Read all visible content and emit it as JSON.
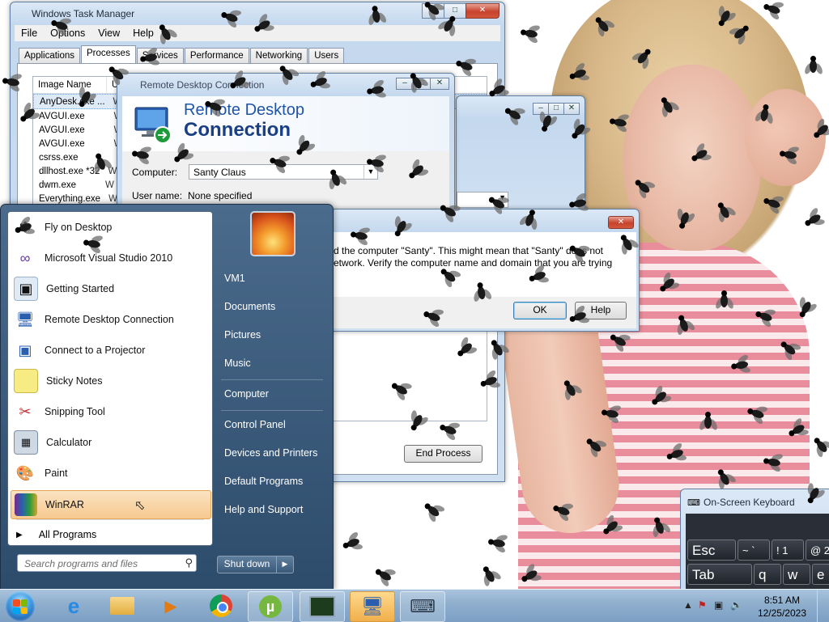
{
  "taskmanager": {
    "title": "Windows Task Manager",
    "menu": [
      "File",
      "Options",
      "View",
      "Help"
    ],
    "tabs": [
      "Applications",
      "Processes",
      "Services",
      "Performance",
      "Networking",
      "Users"
    ],
    "active_tab": "Processes",
    "columns": [
      "Image Name",
      "U"
    ],
    "rows": [
      {
        "name": "AnyDesk.exe ...",
        "u": "W"
      },
      {
        "name": "AVGUI.exe",
        "u": "W"
      },
      {
        "name": "AVGUI.exe",
        "u": "W"
      },
      {
        "name": "AVGUI.exe",
        "u": "W"
      },
      {
        "name": "csrss.exe",
        "u": ""
      },
      {
        "name": "dllhost.exe *32",
        "u": "W"
      },
      {
        "name": "dwm.exe",
        "u": "W"
      },
      {
        "name": "Everything.exe",
        "u": "W"
      }
    ],
    "end_process": "End Process"
  },
  "rdc": {
    "title": "Remote Desktop Connection",
    "banner_line1": "Remote Desktop",
    "banner_line2": "Connection",
    "computer_label": "Computer:",
    "computer_value": "Santy Claus",
    "username_label": "User name:",
    "username_value": "None specified"
  },
  "error_dialog": {
    "message_line1": "d the computer \"Santy\". This might mean that \"Santy\" does not",
    "message_line2": "etwork.  Verify the computer name and domain that you are trying",
    "ok": "OK",
    "help": "Help"
  },
  "start_menu": {
    "programs": [
      {
        "label": "Fly on Desktop",
        "icon": "fly-icon"
      },
      {
        "label": "Microsoft Visual Studio 2010",
        "icon": "visual-studio-icon"
      },
      {
        "label": "Getting Started",
        "icon": "getting-started-icon"
      },
      {
        "label": "Remote Desktop Connection",
        "icon": "remote-desktop-icon"
      },
      {
        "label": "Connect to a Projector",
        "icon": "projector-icon"
      },
      {
        "label": "Sticky Notes",
        "icon": "sticky-notes-icon"
      },
      {
        "label": "Snipping Tool",
        "icon": "snipping-tool-icon"
      },
      {
        "label": "Calculator",
        "icon": "calculator-icon"
      },
      {
        "label": "Paint",
        "icon": "paint-icon"
      },
      {
        "label": "WinRAR",
        "icon": "winrar-icon"
      }
    ],
    "all_programs": "All Programs",
    "search_placeholder": "Search programs and files",
    "right_items": [
      "VM1",
      "Documents",
      "Pictures",
      "Music",
      "Computer",
      "Control Panel",
      "Devices and Printers",
      "Default Programs",
      "Help and Support"
    ],
    "shutdown": "Shut down"
  },
  "osk": {
    "title": "On-Screen Keyboard",
    "keys_row1": [
      "Esc",
      "~ `",
      "! 1",
      "@ 2"
    ],
    "keys_row2": [
      "Tab",
      "q",
      "w",
      "e"
    ]
  },
  "taskbar": {
    "pinned": [
      "ie-icon",
      "explorer-icon",
      "media-player-icon",
      "chrome-icon",
      "utorrent-icon",
      "task-manager-icon",
      "remote-desktop-icon",
      "on-screen-keyboard-icon"
    ],
    "time": "8:51 AM",
    "date": "12/25/2023"
  },
  "colors": {
    "accent": "#1f55a6",
    "taskbar": "#8eaecd",
    "start_menu": "#2d4c6c",
    "highlight": "#f6c98f"
  }
}
